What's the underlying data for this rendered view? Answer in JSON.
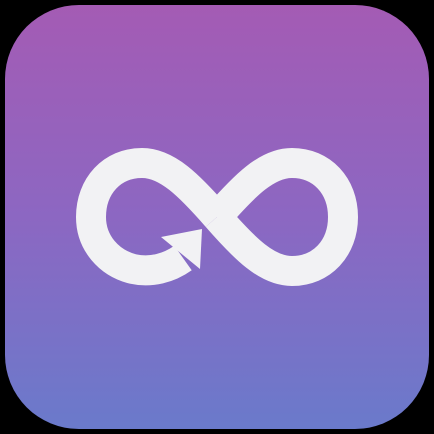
{
  "app_icon": {
    "icon": "infinity-arrow-icon",
    "colors": {
      "gradient_top": "#a45bb4",
      "gradient_mid": "#8c67c2",
      "gradient_bottom": "#6a7acb",
      "glyph": "#f2f2f4",
      "background": "#000000"
    }
  }
}
